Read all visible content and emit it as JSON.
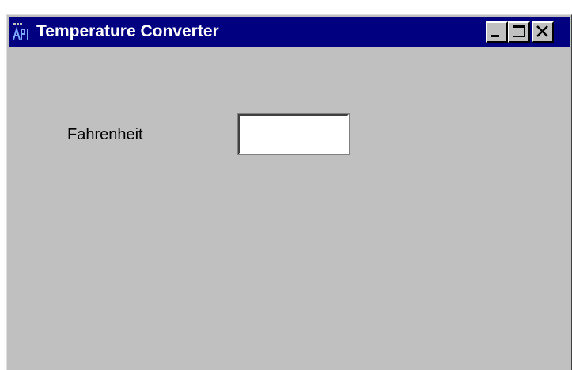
{
  "window": {
    "title": "Temperature Converter",
    "app_icon": "api-app-icon",
    "controls": {
      "minimize": "minimize-icon",
      "maximize": "maximize-icon",
      "close": "close-icon"
    }
  },
  "form": {
    "fahrenheit_label": "Fahrenheit",
    "fahrenheit_value": "",
    "fahrenheit_placeholder": ""
  },
  "colors": {
    "titlebar": "#000080",
    "window_face": "#c0c0c0",
    "title_text": "#ffffff"
  }
}
